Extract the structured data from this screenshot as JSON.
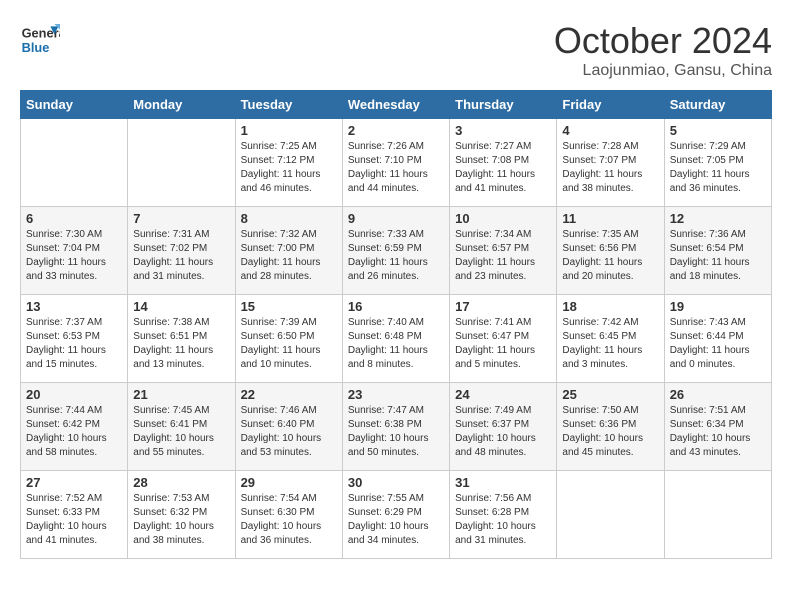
{
  "header": {
    "logo_line1": "General",
    "logo_line2": "Blue",
    "month_title": "October 2024",
    "location": "Laojunmiao, Gansu, China"
  },
  "days_of_week": [
    "Sunday",
    "Monday",
    "Tuesday",
    "Wednesday",
    "Thursday",
    "Friday",
    "Saturday"
  ],
  "weeks": [
    [
      {
        "day": null,
        "info": null
      },
      {
        "day": null,
        "info": null
      },
      {
        "day": "1",
        "info": "Sunrise: 7:25 AM\nSunset: 7:12 PM\nDaylight: 11 hours\nand 46 minutes."
      },
      {
        "day": "2",
        "info": "Sunrise: 7:26 AM\nSunset: 7:10 PM\nDaylight: 11 hours\nand 44 minutes."
      },
      {
        "day": "3",
        "info": "Sunrise: 7:27 AM\nSunset: 7:08 PM\nDaylight: 11 hours\nand 41 minutes."
      },
      {
        "day": "4",
        "info": "Sunrise: 7:28 AM\nSunset: 7:07 PM\nDaylight: 11 hours\nand 38 minutes."
      },
      {
        "day": "5",
        "info": "Sunrise: 7:29 AM\nSunset: 7:05 PM\nDaylight: 11 hours\nand 36 minutes."
      }
    ],
    [
      {
        "day": "6",
        "info": "Sunrise: 7:30 AM\nSunset: 7:04 PM\nDaylight: 11 hours\nand 33 minutes."
      },
      {
        "day": "7",
        "info": "Sunrise: 7:31 AM\nSunset: 7:02 PM\nDaylight: 11 hours\nand 31 minutes."
      },
      {
        "day": "8",
        "info": "Sunrise: 7:32 AM\nSunset: 7:00 PM\nDaylight: 11 hours\nand 28 minutes."
      },
      {
        "day": "9",
        "info": "Sunrise: 7:33 AM\nSunset: 6:59 PM\nDaylight: 11 hours\nand 26 minutes."
      },
      {
        "day": "10",
        "info": "Sunrise: 7:34 AM\nSunset: 6:57 PM\nDaylight: 11 hours\nand 23 minutes."
      },
      {
        "day": "11",
        "info": "Sunrise: 7:35 AM\nSunset: 6:56 PM\nDaylight: 11 hours\nand 20 minutes."
      },
      {
        "day": "12",
        "info": "Sunrise: 7:36 AM\nSunset: 6:54 PM\nDaylight: 11 hours\nand 18 minutes."
      }
    ],
    [
      {
        "day": "13",
        "info": "Sunrise: 7:37 AM\nSunset: 6:53 PM\nDaylight: 11 hours\nand 15 minutes."
      },
      {
        "day": "14",
        "info": "Sunrise: 7:38 AM\nSunset: 6:51 PM\nDaylight: 11 hours\nand 13 minutes."
      },
      {
        "day": "15",
        "info": "Sunrise: 7:39 AM\nSunset: 6:50 PM\nDaylight: 11 hours\nand 10 minutes."
      },
      {
        "day": "16",
        "info": "Sunrise: 7:40 AM\nSunset: 6:48 PM\nDaylight: 11 hours\nand 8 minutes."
      },
      {
        "day": "17",
        "info": "Sunrise: 7:41 AM\nSunset: 6:47 PM\nDaylight: 11 hours\nand 5 minutes."
      },
      {
        "day": "18",
        "info": "Sunrise: 7:42 AM\nSunset: 6:45 PM\nDaylight: 11 hours\nand 3 minutes."
      },
      {
        "day": "19",
        "info": "Sunrise: 7:43 AM\nSunset: 6:44 PM\nDaylight: 11 hours\nand 0 minutes."
      }
    ],
    [
      {
        "day": "20",
        "info": "Sunrise: 7:44 AM\nSunset: 6:42 PM\nDaylight: 10 hours\nand 58 minutes."
      },
      {
        "day": "21",
        "info": "Sunrise: 7:45 AM\nSunset: 6:41 PM\nDaylight: 10 hours\nand 55 minutes."
      },
      {
        "day": "22",
        "info": "Sunrise: 7:46 AM\nSunset: 6:40 PM\nDaylight: 10 hours\nand 53 minutes."
      },
      {
        "day": "23",
        "info": "Sunrise: 7:47 AM\nSunset: 6:38 PM\nDaylight: 10 hours\nand 50 minutes."
      },
      {
        "day": "24",
        "info": "Sunrise: 7:49 AM\nSunset: 6:37 PM\nDaylight: 10 hours\nand 48 minutes."
      },
      {
        "day": "25",
        "info": "Sunrise: 7:50 AM\nSunset: 6:36 PM\nDaylight: 10 hours\nand 45 minutes."
      },
      {
        "day": "26",
        "info": "Sunrise: 7:51 AM\nSunset: 6:34 PM\nDaylight: 10 hours\nand 43 minutes."
      }
    ],
    [
      {
        "day": "27",
        "info": "Sunrise: 7:52 AM\nSunset: 6:33 PM\nDaylight: 10 hours\nand 41 minutes."
      },
      {
        "day": "28",
        "info": "Sunrise: 7:53 AM\nSunset: 6:32 PM\nDaylight: 10 hours\nand 38 minutes."
      },
      {
        "day": "29",
        "info": "Sunrise: 7:54 AM\nSunset: 6:30 PM\nDaylight: 10 hours\nand 36 minutes."
      },
      {
        "day": "30",
        "info": "Sunrise: 7:55 AM\nSunset: 6:29 PM\nDaylight: 10 hours\nand 34 minutes."
      },
      {
        "day": "31",
        "info": "Sunrise: 7:56 AM\nSunset: 6:28 PM\nDaylight: 10 hours\nand 31 minutes."
      },
      {
        "day": null,
        "info": null
      },
      {
        "day": null,
        "info": null
      }
    ]
  ]
}
